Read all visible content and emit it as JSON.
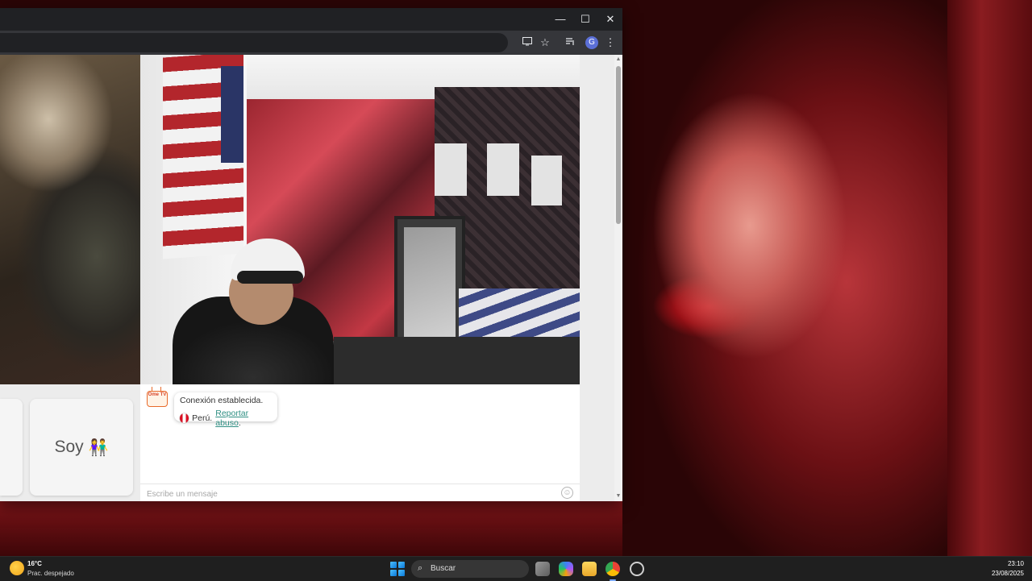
{
  "window": {
    "controls": {
      "minimize": "—",
      "maximize": "☐",
      "close": "✕"
    }
  },
  "toolbar": {
    "profile_initial": "G",
    "icons": [
      "cast-icon",
      "bookmark-star-icon",
      "media-control-icon",
      "profile-avatar",
      "menu-kebab-icon"
    ]
  },
  "page": {
    "interest_card_label": "Soy",
    "chat": {
      "status_message": "Conexión establecida.",
      "country": "Perú.",
      "report_link": "Reportar abuso",
      "report_suffix": ".",
      "logo_text": "Ome TV",
      "input_placeholder": "Escribe un mensaje"
    }
  },
  "taskbar": {
    "weather": {
      "temp": "16°C",
      "condition": "Prac. despejado"
    },
    "search_label": "Buscar",
    "clock": {
      "time": "23:10",
      "date": "23/08/2025"
    }
  },
  "colors": {
    "link": "#2f8f83",
    "taskbar_bg": "#1f1f1f",
    "titlebar_bg": "#202124"
  }
}
